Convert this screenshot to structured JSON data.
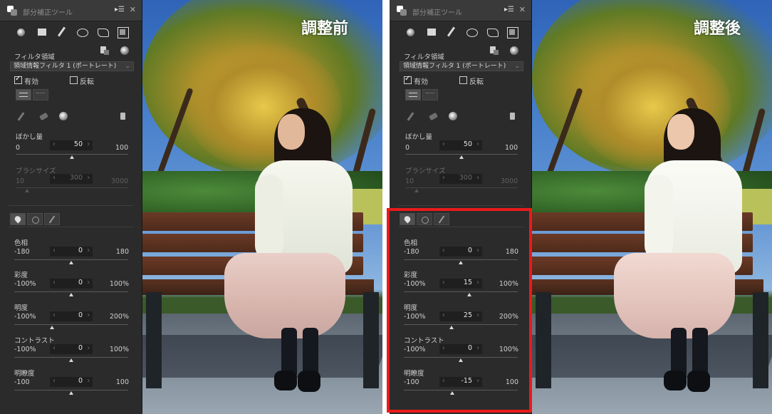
{
  "panel": {
    "title": "部分補正ツール",
    "filter_area_label": "フィルタ領域",
    "filter_dropdown_value": "領域情報フィルタ 1 (ポートレート)",
    "enabled_label": "有効",
    "invert_label": "反転",
    "blur_label": "ぼかし量",
    "blur_min": "0",
    "blur_max": "100",
    "blur_value": "50",
    "brush_label": "ブラシサイズ",
    "brush_min": "10",
    "brush_max": "3000",
    "brush_value": "300",
    "hue_label": "色相",
    "saturation_label": "彩度",
    "brightness_label": "明度",
    "contrast_label": "コントラスト",
    "clarity_label": "明瞭度",
    "hue_min": "-180",
    "hue_max": "180",
    "saturation_min": "-100%",
    "saturation_max": "100%",
    "brightness_min": "-100%",
    "brightness_max": "200%",
    "contrast_min": "-100%",
    "contrast_max": "100%",
    "clarity_min": "-100",
    "clarity_max": "100",
    "arrow_left": "‹",
    "arrow_right": "›",
    "menu_glyph": "▸☰",
    "close_glyph": "✕",
    "chevron": "⌄"
  },
  "before": {
    "caption": "調整前",
    "hue": "0",
    "saturation": "0",
    "brightness": "0",
    "contrast": "0",
    "clarity": "0"
  },
  "after": {
    "caption": "調整後",
    "hue": "0",
    "saturation": "15",
    "brightness": "25",
    "contrast": "0",
    "clarity": "-15"
  },
  "slider_levels": {
    "blur": 0.5,
    "brush": 0.1,
    "before": {
      "hue": 0.5,
      "saturation": 0.5,
      "brightness": 0.3333,
      "contrast": 0.5,
      "clarity": 0.5
    },
    "after": {
      "hue": 0.5,
      "saturation": 0.575,
      "brightness": 0.4167,
      "contrast": 0.5,
      "clarity": 0.425
    }
  },
  "colors": {
    "panel_bg": "#2b2b2b",
    "highlight_border": "#ea1a1a",
    "caption_text": "#ffffff"
  },
  "icons": [
    "app-icon",
    "panel-menu-icon",
    "close-icon",
    "sphere-tool-icon",
    "rectangle-tool-icon",
    "brush-tool-icon",
    "ellipse-tool-icon",
    "polygon-tool-icon",
    "frame-tool-icon",
    "copy-icon",
    "sphere-icon",
    "pen-add-icon",
    "eraser-icon",
    "swap-icon",
    "trash-icon",
    "color-drop-icon",
    "sun-icon",
    "wand-icon"
  ]
}
